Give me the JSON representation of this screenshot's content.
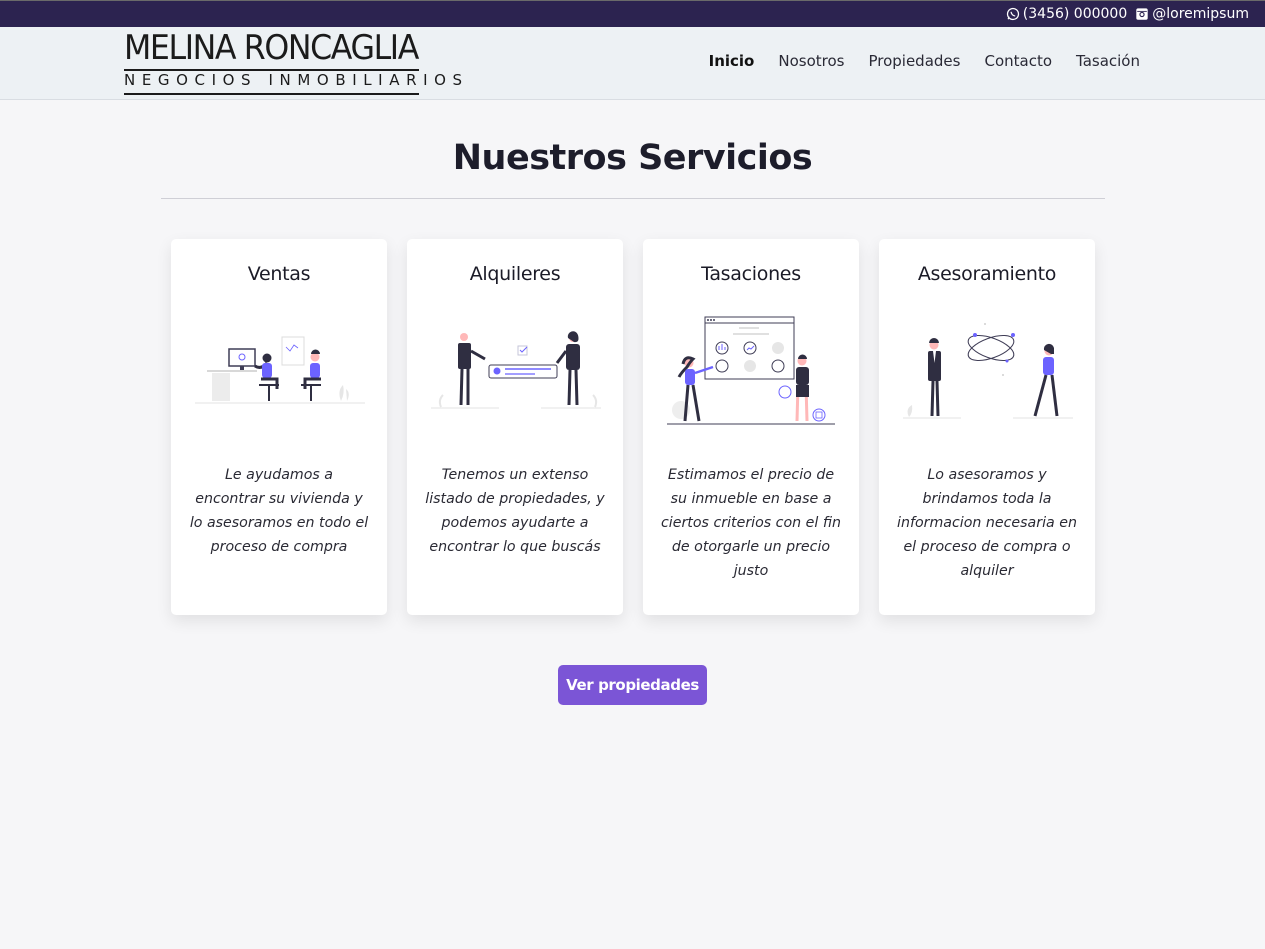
{
  "topbar": {
    "phone": "(3456) 000000",
    "instagram": "@loremipsum",
    "phone_icon": "whatsapp-icon",
    "instagram_icon": "instagram-icon"
  },
  "header": {
    "logo_name": "MELINA RONCAGLIA",
    "logo_tagline": "NEGOCIOS INMOBILIARIOS",
    "nav": [
      "Inicio",
      "Nosotros",
      "Propiedades",
      "Contacto",
      "Tasación"
    ],
    "active_nav": "Inicio"
  },
  "main": {
    "title": "Nuestros Servicios",
    "cards": [
      {
        "title": "Ventas",
        "text": "Le ayudamos a encontrar su vivienda y lo asesoramos en todo el proceso de compra"
      },
      {
        "title": "Alquileres",
        "text": "Tenemos un extenso listado de propiedades, y podemos ayudarte a encontrar lo que buscás"
      },
      {
        "title": "Tasaciones",
        "text": "Estimamos el precio de su inmueble en base a ciertos criterios con el fin de otorgarle un precio justo"
      },
      {
        "title": "Asesoramiento",
        "text": "Lo asesoramos y brindamos toda la informacion necesaria en el proceso de compra o alquiler"
      }
    ],
    "button_label": "Ver propiedades"
  },
  "colors": {
    "topbar": "#2c2350",
    "accent": "#7b55d6",
    "illustration_accent": "#6c63ff"
  }
}
